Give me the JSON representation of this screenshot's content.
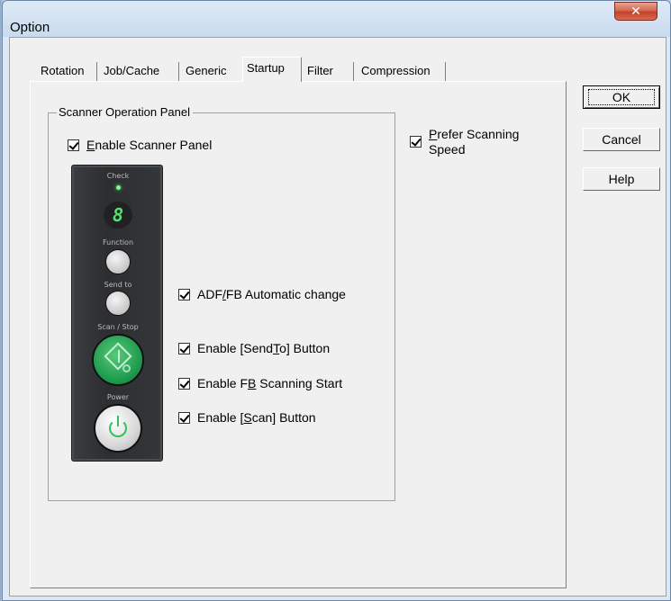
{
  "window": {
    "title": "Option",
    "close_label": "✕"
  },
  "tabs": [
    "Rotation",
    "Job/Cache",
    "Generic",
    "Startup",
    "Filter",
    "Compression"
  ],
  "active_tab": "Startup",
  "group": {
    "title": "Scanner Operation Panel"
  },
  "checkboxes": {
    "enable_panel": {
      "pre": "",
      "u": "E",
      "post": "nable Scanner Panel",
      "checked": true
    },
    "prefer_speed": {
      "pre": "",
      "u": "P",
      "post": "refer Scanning",
      "line2": "Speed",
      "checked": true
    },
    "adf_fb": {
      "pre": "ADF",
      "u": "/",
      "post": "FB Automatic change",
      "checked": true
    },
    "sendto": {
      "pre": "Enable [Send",
      "u": "T",
      "post": "o] Button",
      "checked": true
    },
    "fb_start": {
      "pre": "Enable F",
      "u": "B",
      "post": " Scanning Start",
      "checked": true
    },
    "scan_btn": {
      "pre": "Enable [",
      "u": "S",
      "post": "can] Button",
      "checked": true
    }
  },
  "buttons": {
    "ok": "OK",
    "cancel": "Cancel",
    "help": "Help"
  },
  "panel": {
    "check_label": "Check",
    "digit": "8",
    "function_label": "Function",
    "sendto_label": "Send to",
    "scanstop_label": "Scan / Stop",
    "power_label": "Power",
    "led_color": "#7cfc8a",
    "scan_color": "#1d9a4d"
  }
}
